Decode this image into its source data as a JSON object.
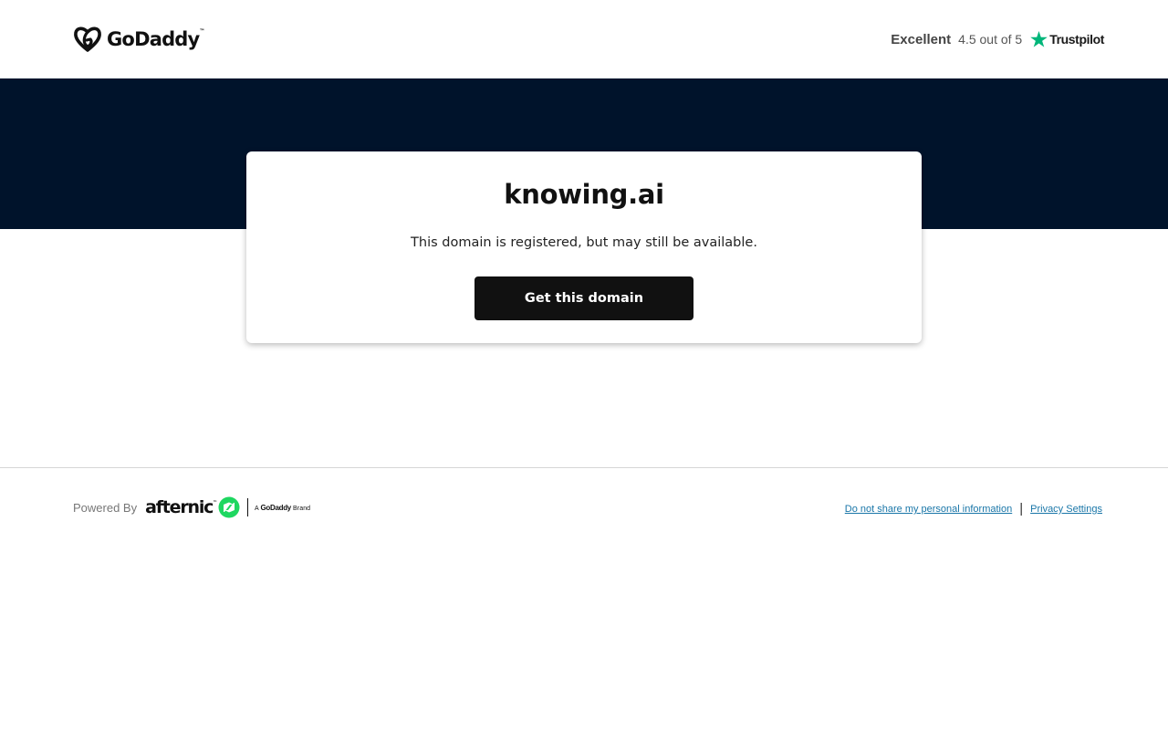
{
  "header": {
    "logo_text": "GoDaddy",
    "logo_tm": "™",
    "rating_word": "Excellent",
    "rating_score": "4.5 out of 5",
    "trustpilot_text": "Trustpilot"
  },
  "card": {
    "domain": "knowing.ai",
    "subtitle": "This domain is registered, but may still be available.",
    "cta_label": "Get this domain"
  },
  "footer": {
    "powered_by": "Powered By",
    "afternic_text": "afternic",
    "afternic_tm": "™",
    "brand_prefix": "A",
    "brand_name": "GoDaddy",
    "brand_suffix": "Brand",
    "links": [
      "Do not share my personal information",
      "Privacy Settings"
    ],
    "link_separator": "|"
  },
  "icons": {
    "logo": "godaddy-logo-icon",
    "star": "trustpilot-star-icon",
    "afternic": "afternic-arrows-icon"
  },
  "colors": {
    "hero_bg": "#00132b",
    "cta_bg": "#111111",
    "trustpilot_green": "#00b67a",
    "afternic_green": "#1ed760",
    "link": "#1976a8",
    "divider": "#d6d6d6"
  }
}
